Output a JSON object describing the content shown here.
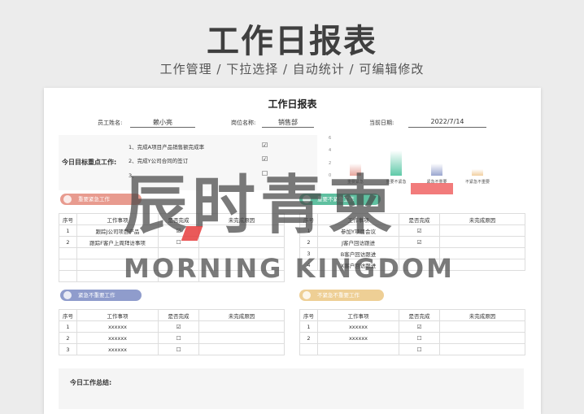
{
  "hero": {
    "title": "工作日报表",
    "subtitle": "工作管理 / 下拉选择 / 自动统计 / 可编辑修改"
  },
  "sheet": {
    "title": "工作日报表",
    "employee_label": "员工姓名:",
    "employee_value": "赖小亮",
    "position_label": "岗位名称:",
    "position_value": "销售部",
    "date_label": "当前日期:",
    "date_value": "2022/7/14"
  },
  "goals": {
    "label": "今日目标重点工作:",
    "items": [
      {
        "text": "1、完成A项目产品销售额完成率",
        "check": "☑"
      },
      {
        "text": "2、完成Y公司合同的签订",
        "check": "☑"
      },
      {
        "text": "3、",
        "check": "☐"
      }
    ]
  },
  "chart_data": {
    "type": "bar",
    "categories": [
      "重要紧急",
      "重要不紧急",
      "紧急不重要",
      "不紧急不重要"
    ],
    "values": [
      2,
      4,
      2,
      1
    ],
    "ylim": [
      0,
      6
    ],
    "yticks": [
      "6",
      "4",
      "2",
      "0"
    ],
    "colors": [
      "#e8a59c",
      "#5fc9a8",
      "#9aa6cf",
      "#f2cfa0"
    ],
    "grid": false
  },
  "sections": {
    "q1": {
      "title": "重要紧急工作",
      "color": "#e89b8f"
    },
    "q2": {
      "title": "重要不紧急工作",
      "color": "#5fc0a0"
    },
    "q3": {
      "title": "紧急不重要工作",
      "color": "#8f9ccc"
    },
    "q4": {
      "title": "不紧急不重要工作",
      "color": "#eecf95"
    }
  },
  "columns": [
    "序号",
    "工作事项",
    "是否完成",
    "未完成原因"
  ],
  "tables": {
    "t1": [
      {
        "n": "1",
        "item": "跟踪J公司项目产品",
        "done": "☑"
      },
      {
        "n": "2",
        "item": "跟踪F客户上周拜访事项",
        "done": "☐"
      },
      {
        "n": "",
        "item": "",
        "done": ""
      },
      {
        "n": "",
        "item": "",
        "done": ""
      },
      {
        "n": "",
        "item": "",
        "done": ""
      }
    ],
    "t2": [
      {
        "n": "1",
        "item": "参加Y项目会议",
        "done": "☑"
      },
      {
        "n": "2",
        "item": "J客户回访跟进",
        "done": "☑"
      },
      {
        "n": "3",
        "item": "B客户回访跟进",
        "done": ""
      },
      {
        "n": "4",
        "item": "X客户回访跟进",
        "done": ""
      }
    ],
    "t3": [
      {
        "n": "1",
        "item": "xxxxxx",
        "done": "☑"
      },
      {
        "n": "2",
        "item": "xxxxxx",
        "done": "☐"
      },
      {
        "n": "3",
        "item": "xxxxxx",
        "done": "☐"
      }
    ],
    "t4": [
      {
        "n": "1",
        "item": "xxxxxx",
        "done": "☑"
      },
      {
        "n": "2",
        "item": "xxxxxx",
        "done": "☐"
      },
      {
        "n": "",
        "item": "",
        "done": "☐"
      }
    ]
  },
  "summary_label": "今日工作总结:",
  "watermark": {
    "cn": "辰时青柬",
    "en": "MORNING KINGDOM"
  }
}
